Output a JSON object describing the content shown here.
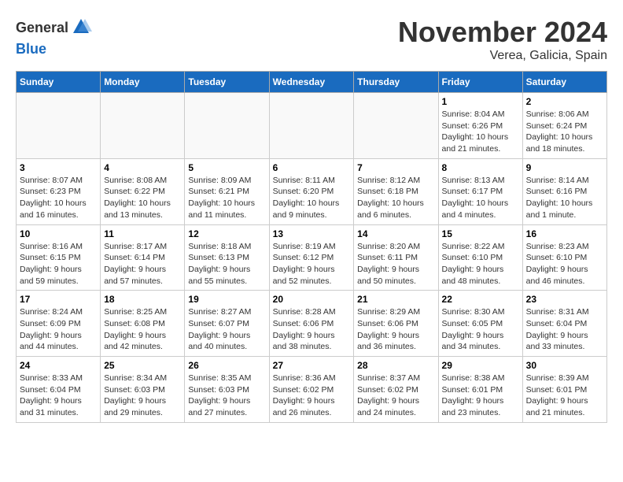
{
  "header": {
    "logo_line1": "General",
    "logo_line2": "Blue",
    "month_title": "November 2024",
    "location": "Verea, Galicia, Spain"
  },
  "days_of_week": [
    "Sunday",
    "Monday",
    "Tuesday",
    "Wednesday",
    "Thursday",
    "Friday",
    "Saturday"
  ],
  "weeks": [
    [
      {
        "day": "",
        "info": ""
      },
      {
        "day": "",
        "info": ""
      },
      {
        "day": "",
        "info": ""
      },
      {
        "day": "",
        "info": ""
      },
      {
        "day": "",
        "info": ""
      },
      {
        "day": "1",
        "info": "Sunrise: 8:04 AM\nSunset: 6:26 PM\nDaylight: 10 hours and 21 minutes."
      },
      {
        "day": "2",
        "info": "Sunrise: 8:06 AM\nSunset: 6:24 PM\nDaylight: 10 hours and 18 minutes."
      }
    ],
    [
      {
        "day": "3",
        "info": "Sunrise: 8:07 AM\nSunset: 6:23 PM\nDaylight: 10 hours and 16 minutes."
      },
      {
        "day": "4",
        "info": "Sunrise: 8:08 AM\nSunset: 6:22 PM\nDaylight: 10 hours and 13 minutes."
      },
      {
        "day": "5",
        "info": "Sunrise: 8:09 AM\nSunset: 6:21 PM\nDaylight: 10 hours and 11 minutes."
      },
      {
        "day": "6",
        "info": "Sunrise: 8:11 AM\nSunset: 6:20 PM\nDaylight: 10 hours and 9 minutes."
      },
      {
        "day": "7",
        "info": "Sunrise: 8:12 AM\nSunset: 6:18 PM\nDaylight: 10 hours and 6 minutes."
      },
      {
        "day": "8",
        "info": "Sunrise: 8:13 AM\nSunset: 6:17 PM\nDaylight: 10 hours and 4 minutes."
      },
      {
        "day": "9",
        "info": "Sunrise: 8:14 AM\nSunset: 6:16 PM\nDaylight: 10 hours and 1 minute."
      }
    ],
    [
      {
        "day": "10",
        "info": "Sunrise: 8:16 AM\nSunset: 6:15 PM\nDaylight: 9 hours and 59 minutes."
      },
      {
        "day": "11",
        "info": "Sunrise: 8:17 AM\nSunset: 6:14 PM\nDaylight: 9 hours and 57 minutes."
      },
      {
        "day": "12",
        "info": "Sunrise: 8:18 AM\nSunset: 6:13 PM\nDaylight: 9 hours and 55 minutes."
      },
      {
        "day": "13",
        "info": "Sunrise: 8:19 AM\nSunset: 6:12 PM\nDaylight: 9 hours and 52 minutes."
      },
      {
        "day": "14",
        "info": "Sunrise: 8:20 AM\nSunset: 6:11 PM\nDaylight: 9 hours and 50 minutes."
      },
      {
        "day": "15",
        "info": "Sunrise: 8:22 AM\nSunset: 6:10 PM\nDaylight: 9 hours and 48 minutes."
      },
      {
        "day": "16",
        "info": "Sunrise: 8:23 AM\nSunset: 6:10 PM\nDaylight: 9 hours and 46 minutes."
      }
    ],
    [
      {
        "day": "17",
        "info": "Sunrise: 8:24 AM\nSunset: 6:09 PM\nDaylight: 9 hours and 44 minutes."
      },
      {
        "day": "18",
        "info": "Sunrise: 8:25 AM\nSunset: 6:08 PM\nDaylight: 9 hours and 42 minutes."
      },
      {
        "day": "19",
        "info": "Sunrise: 8:27 AM\nSunset: 6:07 PM\nDaylight: 9 hours and 40 minutes."
      },
      {
        "day": "20",
        "info": "Sunrise: 8:28 AM\nSunset: 6:06 PM\nDaylight: 9 hours and 38 minutes."
      },
      {
        "day": "21",
        "info": "Sunrise: 8:29 AM\nSunset: 6:06 PM\nDaylight: 9 hours and 36 minutes."
      },
      {
        "day": "22",
        "info": "Sunrise: 8:30 AM\nSunset: 6:05 PM\nDaylight: 9 hours and 34 minutes."
      },
      {
        "day": "23",
        "info": "Sunrise: 8:31 AM\nSunset: 6:04 PM\nDaylight: 9 hours and 33 minutes."
      }
    ],
    [
      {
        "day": "24",
        "info": "Sunrise: 8:33 AM\nSunset: 6:04 PM\nDaylight: 9 hours and 31 minutes."
      },
      {
        "day": "25",
        "info": "Sunrise: 8:34 AM\nSunset: 6:03 PM\nDaylight: 9 hours and 29 minutes."
      },
      {
        "day": "26",
        "info": "Sunrise: 8:35 AM\nSunset: 6:03 PM\nDaylight: 9 hours and 27 minutes."
      },
      {
        "day": "27",
        "info": "Sunrise: 8:36 AM\nSunset: 6:02 PM\nDaylight: 9 hours and 26 minutes."
      },
      {
        "day": "28",
        "info": "Sunrise: 8:37 AM\nSunset: 6:02 PM\nDaylight: 9 hours and 24 minutes."
      },
      {
        "day": "29",
        "info": "Sunrise: 8:38 AM\nSunset: 6:01 PM\nDaylight: 9 hours and 23 minutes."
      },
      {
        "day": "30",
        "info": "Sunrise: 8:39 AM\nSunset: 6:01 PM\nDaylight: 9 hours and 21 minutes."
      }
    ]
  ]
}
